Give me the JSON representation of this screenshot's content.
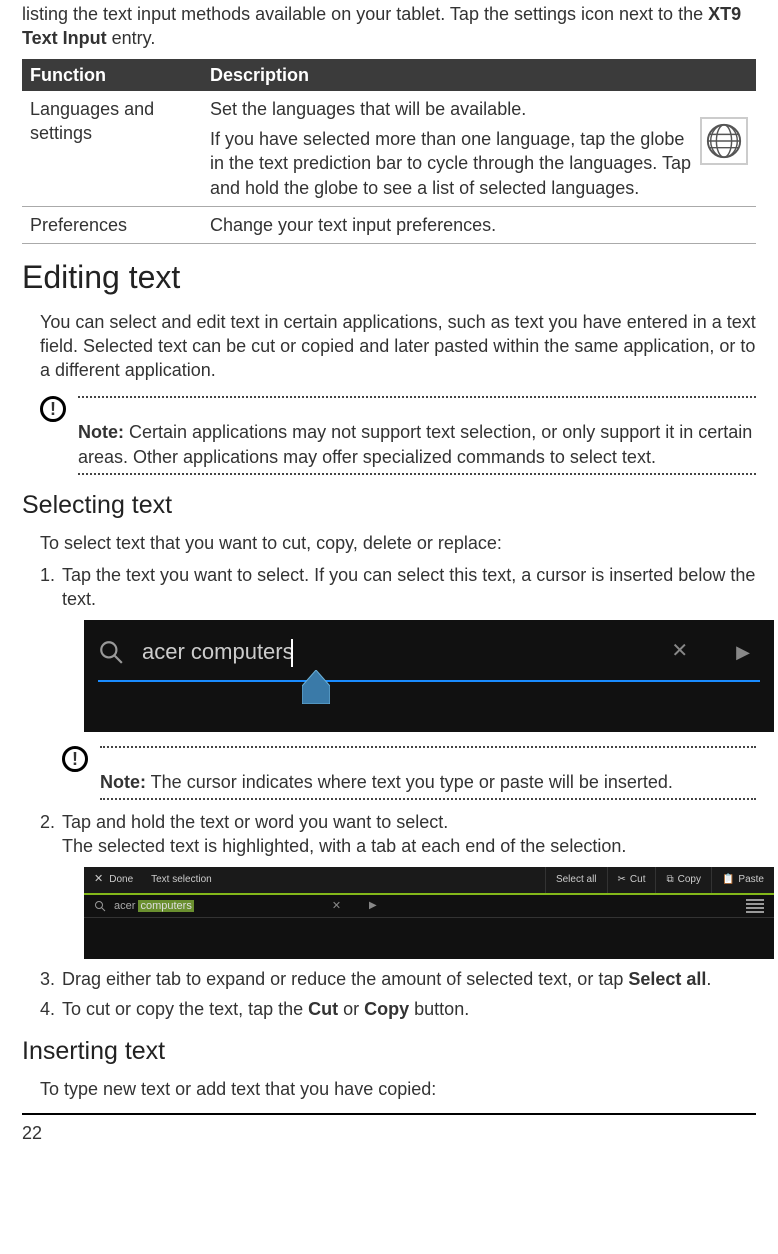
{
  "intro": {
    "pre": "listing the text input methods available on your tablet. Tap the settings icon next to the ",
    "bold": "XT9 Text Input",
    "post": " entry."
  },
  "table": {
    "headers": {
      "col1": "Function",
      "col2": "Description"
    },
    "row1": {
      "func": "Languages and settings",
      "desc_p1": "Set the languages that will be available.",
      "desc_p2": "If you have selected more than one language, tap the globe in the text prediction bar to cycle through the languages. Tap and hold the globe to see a list of selected languages."
    },
    "row2": {
      "func": "Preferences",
      "desc": "Change your text input preferences."
    }
  },
  "h_editing": "Editing text",
  "editing_p": "You can select and edit text in certain applications, such as text you have entered in a text field. Selected text can be cut or copied and later pasted within the same application, or to a different application.",
  "note1": {
    "label": "Note:",
    "text": " Certain applications may not support text selection, or only support it in certain areas. Other applications may offer specialized commands to select text."
  },
  "h_selecting": "Selecting text",
  "selecting_p": "To select text that you want to cut, copy, delete or replace:",
  "steps": {
    "s1": "Tap the text you want to select. If you can select this text, a cursor is inserted below the text.",
    "s2_a": "Tap and hold the text or word you want to select.",
    "s2_b": "The selected text is highlighted, with a tab at each end of the selection.",
    "s3_pre": "Drag either tab to expand or reduce the amount of selected text, or tap ",
    "s3_bold": "Select all",
    "s3_post": ".",
    "s4_pre": "To cut or copy the text, tap the ",
    "s4_b1": "Cut",
    "s4_mid": " or ",
    "s4_b2": "Copy",
    "s4_post": " button."
  },
  "ss1": {
    "query": "acer computers"
  },
  "note2": {
    "label": "Note:",
    "text": " The cursor indicates where text you type or paste will be inserted."
  },
  "ss2": {
    "done": "Done",
    "title": "Text selection",
    "select_all": "Select all",
    "cut": "Cut",
    "copy": "Copy",
    "paste": "Paste",
    "q_pre": "acer ",
    "q_sel": "computers"
  },
  "h_inserting": "Inserting text",
  "inserting_p": "To type new text or add text that you have copied:",
  "page": "22"
}
